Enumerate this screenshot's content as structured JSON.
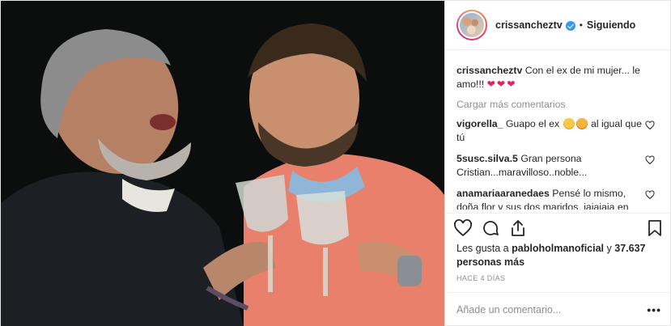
{
  "post": {
    "username": "crissancheztv",
    "follow_status": "Siguiendo",
    "separator": "•",
    "caption_text": "Con el ex de mi mujer... le amo!!!",
    "caption_hearts": "❤❤❤",
    "load_more": "Cargar más comentarios",
    "comments": [
      {
        "user": "vigorella_",
        "text_before": "Guapo el ex",
        "text_after": "al igual que tú"
      },
      {
        "user": "5susc.silva.5",
        "text": "Gran persona Cristian...maravilloso..noble..."
      },
      {
        "user": "anamariaaranedaes",
        "text": "Pensé lo mismo, doña flor y sus dos maridos, jajajaja en bromista no mas"
      }
    ],
    "likes_prefix": "Les gusta a",
    "likes_user": "pabloholmanoficial",
    "likes_and": "y",
    "likes_count": "37.637 personas más",
    "date": "HACE 4 DÍAS",
    "add_comment_placeholder": "Añade un comentario...",
    "more_label": "•••"
  },
  "icons": {
    "verified": "verified-badge-icon",
    "like": "heart-outline-icon",
    "comment": "comment-bubble-icon",
    "share": "share-upload-icon",
    "save": "bookmark-icon"
  },
  "colors": {
    "verified": "#3897f0",
    "hearts": "#e0245e",
    "muted": "#8e8e8e"
  }
}
